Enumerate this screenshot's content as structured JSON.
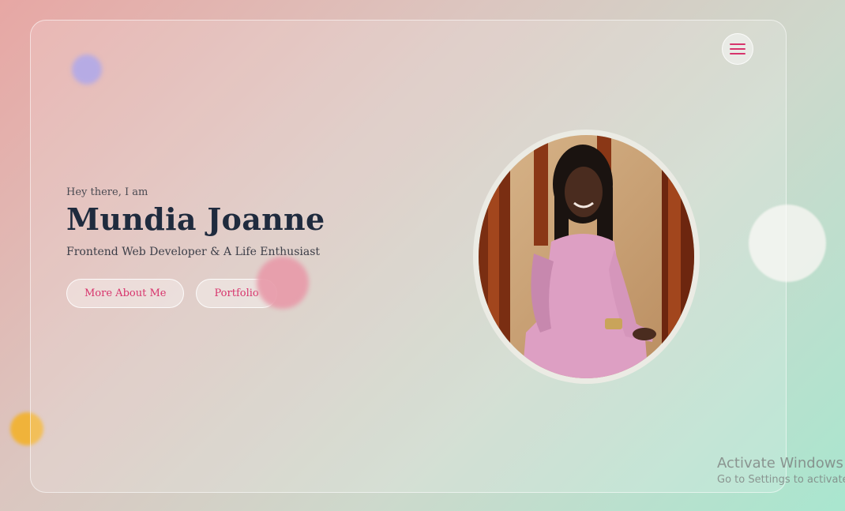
{
  "hero": {
    "greeting": "Hey there, I am",
    "name": "Mundia Joanne",
    "tagline": "Frontend Web Developer & A Life Enthusiast",
    "buttons": [
      {
        "label": "More About Me"
      },
      {
        "label": "Portfolio"
      }
    ]
  },
  "nav": {
    "menu_icon": "hamburger-menu-icon"
  },
  "portrait": {
    "alt": "Portrait photo"
  },
  "watermark": {
    "title": "Activate Windows",
    "subtitle": "Go to Settings to activate"
  },
  "colors": {
    "accent": "#d7346c",
    "heading": "#1f2b3e",
    "blob_purple": "#a99bdf",
    "blob_pink": "#e89aa9",
    "blob_orange": "#f0b33a"
  }
}
